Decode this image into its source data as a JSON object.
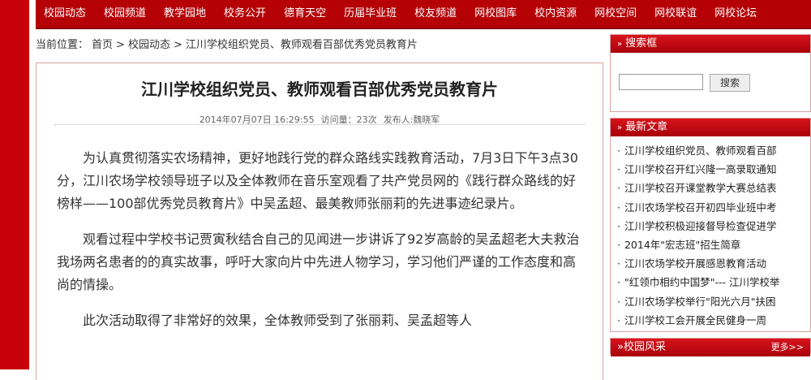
{
  "nav": [
    "校园动态",
    "校园频道",
    "教学园地",
    "校务公开",
    "德育天空",
    "历届毕业班",
    "校友频道",
    "网校图库",
    "校内资源",
    "网校空间",
    "网校联谊",
    "网校论坛"
  ],
  "breadcrumb": {
    "label": "当前位置：",
    "home": "首页",
    "sep1": ">",
    "section": "校园动态",
    "sep2": ">",
    "current": "江川学校组织党员、教师观看百部优秀党员教育片"
  },
  "article": {
    "title": "江川学校组织党员、教师观看百部优秀党员教育片",
    "date": "2014年07月07日 16:29:55",
    "views": "访问量：23次",
    "publisher": "发布人:魏晓军",
    "paragraphs": [
      "为认真贯彻落实农场精神，更好地践行党的群众路线实践教育活动，7月3日下午3点30分，江川农场学校领导班子以及全体教师在音乐室观看了共产党员网的《践行群众路线的好榜样——100部优秀党员教育片》中吴孟超、最美教师张丽莉的先进事迹纪录片。",
      "观看过程中学校书记贾寅秋结合自己的见闻进一步讲诉了92岁高龄的吴孟超老大夫救治我场两名患者的的真实故事，呼吁大家向片中先进人物学习，学习他们严谨的工作态度和高尚的情操。",
      "此次活动取得了非常好的效果，全体教师受到了张丽莉、吴孟超等人"
    ]
  },
  "sidebar": {
    "search_title": "搜索框",
    "search_button": "搜索",
    "search_placeholder": "",
    "latest_title": "最新文章",
    "latest": [
      "江川学校组织党员、教师观看百部",
      "江川学校召开红兴隆一高录取通知",
      "江川学校召开课堂教学大赛总结表",
      "江川农场学校召开初四毕业班中考",
      "江川学校积极迎接督导检查促进学",
      "2014年\"宏志班\"招生简章",
      "江川农场学校开展感恩教育活动",
      "\"红领巾相约中国梦\"--- 江川学校举",
      "江川农场学校举行\"阳光六月\"扶困",
      "江川学校工会开展全民健身一周"
    ],
    "photo_title": "校园风采",
    "more": "更多>>"
  }
}
